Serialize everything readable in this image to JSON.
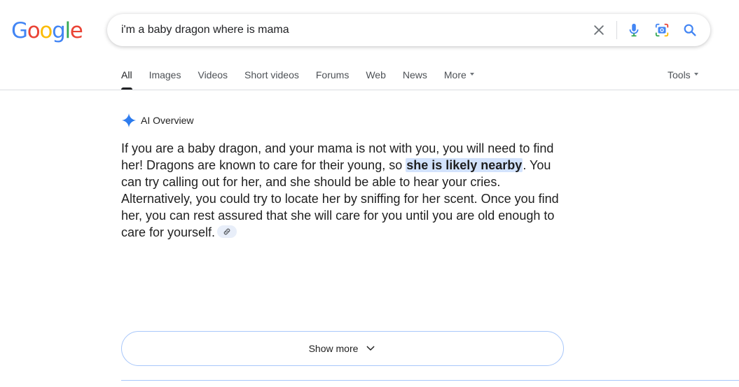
{
  "logo": {
    "letters": [
      "G",
      "o",
      "o",
      "g",
      "l",
      "e"
    ],
    "colors": [
      "#4285F4",
      "#EA4335",
      "#FBBC05",
      "#4285F4",
      "#34A853",
      "#EA4335"
    ]
  },
  "search": {
    "value": "i'm a baby dragon where is mama",
    "icons": [
      "close-icon",
      "microphone-icon",
      "camera-lens-icon",
      "search-icon"
    ]
  },
  "tabs": {
    "items": [
      "All",
      "Images",
      "Videos",
      "Short videos",
      "Forums",
      "Web",
      "News",
      "More"
    ],
    "active": "All",
    "tools": "Tools"
  },
  "ai_overview": {
    "title": "AI Overview",
    "text_before": "If you are a baby dragon, and your mama is not with you, you will need to find her! Dragons are known to care for their young, so ",
    "highlight": "she is likely nearby",
    "text_after": ". You can try calling out for her, and she should be able to hear your cries. Alternatively, you could try to locate her by sniffing for her scent. Once you find her, you can rest assured that she will care for you until you are old enough to care for yourself.",
    "link_icon": "link-icon",
    "show_more": "Show more"
  },
  "colors": {
    "accent_blue": "#4285F4",
    "highlight_bg": "#d3e3fd",
    "show_more_border": "#a8c7fa"
  }
}
